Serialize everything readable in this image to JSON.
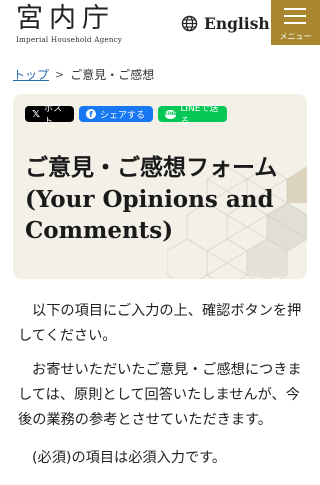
{
  "header": {
    "logo_text": "宮内庁",
    "logo_subtitle": "Imperial Household Agency",
    "language_label": "English",
    "menu_label": "メニュー"
  },
  "breadcrumb": {
    "home": "トップ",
    "separator": ">",
    "current": "ご意見・ご感想"
  },
  "share": {
    "x_label": "ポスト",
    "facebook_label": "シェアする",
    "line_label": "LINEで送る"
  },
  "main": {
    "title": "ご意見・ご感想フォーム (Your Opinions and Comments)",
    "paragraphs": [
      "以下の項目にご入力の上、確認ボタンを押してください。",
      "お寄せいただいたご意見・ご感想につきましては、原則として回答いたしませんが、今後の業務の参考とさせていただきます。",
      "(必須)の項目は必須入力です。"
    ]
  },
  "colors": {
    "menu_bg": "#a8872e",
    "card_bg": "#f3f0e8",
    "link": "#2b6cb0",
    "x_bg": "#000000",
    "facebook_bg": "#1877f2",
    "line_bg": "#06c755"
  },
  "icons": {
    "language": "globe-icon",
    "menu": "hamburger-icon",
    "x": "x-logo-icon",
    "facebook": "facebook-icon",
    "line": "line-icon"
  }
}
